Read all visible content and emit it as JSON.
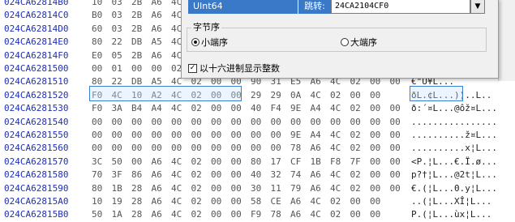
{
  "rows": [
    {
      "addr": "024CA62814B0",
      "bytes": [
        "10",
        "03",
        "2B",
        "A6",
        "4C",
        "",
        "",
        "",
        "",
        "",
        "",
        "",
        "",
        "",
        "",
        ""
      ],
      "ascii": ""
    },
    {
      "addr": "024CA62814C0",
      "bytes": [
        "B0",
        "03",
        "2B",
        "A6",
        "4C",
        "",
        "",
        "",
        "",
        "",
        "",
        "",
        "",
        "",
        "",
        ""
      ],
      "ascii": ""
    },
    {
      "addr": "024CA62814D0",
      "bytes": [
        "60",
        "03",
        "2B",
        "A6",
        "4C",
        "",
        "",
        "",
        "",
        "",
        "",
        "",
        "",
        "",
        "",
        ""
      ],
      "ascii": ""
    },
    {
      "addr": "024CA62814E0",
      "bytes": [
        "80",
        "22",
        "DB",
        "A5",
        "4C",
        "",
        "",
        "",
        "",
        "",
        "",
        "",
        "",
        "",
        "",
        ""
      ],
      "ascii": ""
    },
    {
      "addr": "024CA62814F0",
      "bytes": [
        "E0",
        "05",
        "2B",
        "A6",
        "4C",
        "",
        "",
        "",
        "",
        "",
        "",
        "",
        "",
        "",
        "",
        ""
      ],
      "ascii": ""
    },
    {
      "addr": "024CA6281500",
      "bytes": [
        "00",
        "01",
        "00",
        "00",
        "02",
        "",
        "",
        "",
        "",
        "",
        "",
        "",
        "",
        "",
        "",
        ""
      ],
      "ascii": ""
    },
    {
      "addr": "024CA6281510",
      "bytes": [
        "80",
        "22",
        "DB",
        "A5",
        "4C",
        "02",
        "00",
        "00",
        "90",
        "31",
        "E5",
        "A6",
        "4C",
        "02",
        "00",
        "00"
      ],
      "ascii": "€\"Û¥L..."
    },
    {
      "addr": "024CA6281520",
      "bytes": [
        "F0",
        "4C",
        "10",
        "A2",
        "4C",
        "02",
        "00",
        "00",
        "29",
        "29",
        "0A",
        "4C",
        "02",
        "00",
        "00",
        ""
      ],
      "ascii": "ðL.¢L...))..L.."
    },
    {
      "addr": "024CA6281530",
      "bytes": [
        "F0",
        "3A",
        "B4",
        "A4",
        "4C",
        "02",
        "00",
        "00",
        "40",
        "F4",
        "9E",
        "A4",
        "4C",
        "02",
        "00",
        "00"
      ],
      "ascii": "ð:´¤L...@ôž¤L..."
    },
    {
      "addr": "024CA6281540",
      "bytes": [
        "00",
        "00",
        "00",
        "00",
        "00",
        "00",
        "00",
        "00",
        "00",
        "00",
        "00",
        "00",
        "00",
        "00",
        "00",
        "00"
      ],
      "ascii": "................"
    },
    {
      "addr": "024CA6281550",
      "bytes": [
        "00",
        "00",
        "00",
        "00",
        "00",
        "00",
        "00",
        "00",
        "00",
        "00",
        "9E",
        "A4",
        "4C",
        "02",
        "00",
        "00"
      ],
      "ascii": "..........ž¤L..."
    },
    {
      "addr": "024CA6281560",
      "bottom": true,
      "bytes": [
        "00",
        "00",
        "00",
        "00",
        "00",
        "00",
        "00",
        "00",
        "00",
        "00",
        "78",
        "A6",
        "4C",
        "02",
        "00",
        "00"
      ],
      "ascii": "..........x¦L..."
    },
    {
      "addr": "024CA6281570",
      "bytes": [
        "3C",
        "50",
        "00",
        "A6",
        "4C",
        "02",
        "00",
        "00",
        "80",
        "17",
        "CF",
        "1B",
        "F8",
        "7F",
        "00",
        "00"
      ],
      "ascii": "<P.¦L...€.Ï.ø..."
    },
    {
      "addr": "024CA6281580",
      "bytes": [
        "70",
        "3F",
        "86",
        "A6",
        "4C",
        "02",
        "00",
        "00",
        "40",
        "32",
        "74",
        "A6",
        "4C",
        "02",
        "00",
        "00"
      ],
      "ascii": "p?†¦L...@2t¦L..."
    },
    {
      "addr": "024CA6281590",
      "bytes": [
        "80",
        "1B",
        "28",
        "A6",
        "4C",
        "02",
        "00",
        "00",
        "30",
        "11",
        "79",
        "A6",
        "4C",
        "02",
        "00",
        "00"
      ],
      "ascii": "€.(¦L...0.y¦L..."
    },
    {
      "addr": "024CA62815A0",
      "bytes": [
        "10",
        "19",
        "28",
        "A6",
        "4C",
        "02",
        "00",
        "00",
        "58",
        "CE",
        "A6",
        "4C",
        "02",
        "00",
        "00",
        ""
      ],
      "ascii": "..(¦L...XÎ¦L..."
    },
    {
      "addr": "024CA62815B0",
      "bytes": [
        "50",
        "1A",
        "28",
        "A6",
        "4C",
        "02",
        "00",
        "00",
        "F9",
        "78",
        "A6",
        "4C",
        "02",
        "00",
        "00",
        ""
      ],
      "ascii": "P.(¦L...ùx¦L..."
    }
  ],
  "popup": {
    "type_value": "UInt64",
    "jump_label": "跳转:",
    "jump_value": "24CA2104CF0",
    "byte_order_title": "字节序",
    "little_endian": "小端序",
    "big_endian": "大端序",
    "little_selected": true,
    "hex_int_label": "以十六进制显示整数",
    "hex_int_checked": true
  }
}
